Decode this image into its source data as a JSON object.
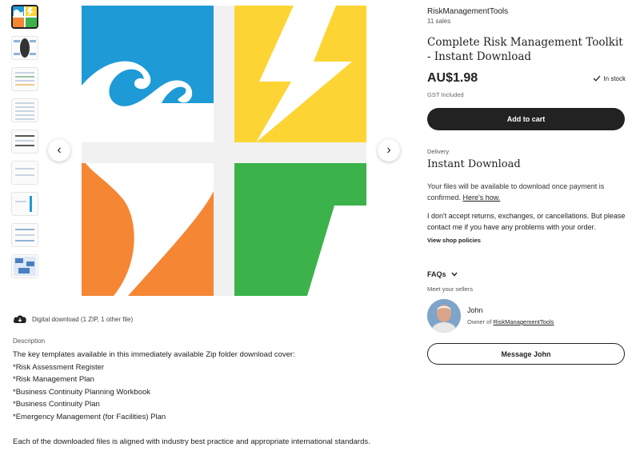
{
  "listing": {
    "shop_name": "RiskManagementTools",
    "sales": "11 sales",
    "title": "Complete Risk Management Toolkit - Instant Download",
    "price": "AU$1.98",
    "stock_status": "In stock",
    "gst_note": "GST Included",
    "add_to_cart_label": "Add to cart"
  },
  "delivery": {
    "label": "Delivery",
    "value": "Instant Download",
    "files_note": "Your files will be available to download once payment is confirmed.",
    "heres_how": "Here's how.",
    "returns_note": "I don't accept returns, exchanges, or cancellations. But please contact me if you have any problems with your order.",
    "shop_policies_link": "View shop policies"
  },
  "faqs_label": "FAQs",
  "seller": {
    "meet_label": "Meet your sellers",
    "name": "John",
    "owner_prefix": "Owner of",
    "owner_shop": "RiskManagementTools",
    "message_label": "Message John"
  },
  "download_info": "Digital download (1 ZIP, 1 other file)",
  "description": {
    "heading": "Description",
    "intro": "The key templates available in this immediately available Zip folder download cover:",
    "items": [
      "*Risk Assessment Register",
      "*Risk Management Plan",
      "*Business Continuity Planning Workbook",
      "*Business Continuity Plan",
      "*Emergency Management (for Facilities) Plan"
    ],
    "closing": "Each of the downloaded files is aligned with industry best practice and appropriate international standards."
  },
  "icons": {
    "prev": "chevron-left-icon",
    "next": "chevron-right-icon",
    "stock": "check-icon",
    "download": "cloud-download-icon",
    "faqs": "chevron-down-icon"
  },
  "colors": {
    "logo_blue": "#1e9ad6",
    "logo_yellow": "#fcd535",
    "logo_orange": "#f58634",
    "logo_green": "#3bb34a",
    "button_dark": "#222222"
  }
}
